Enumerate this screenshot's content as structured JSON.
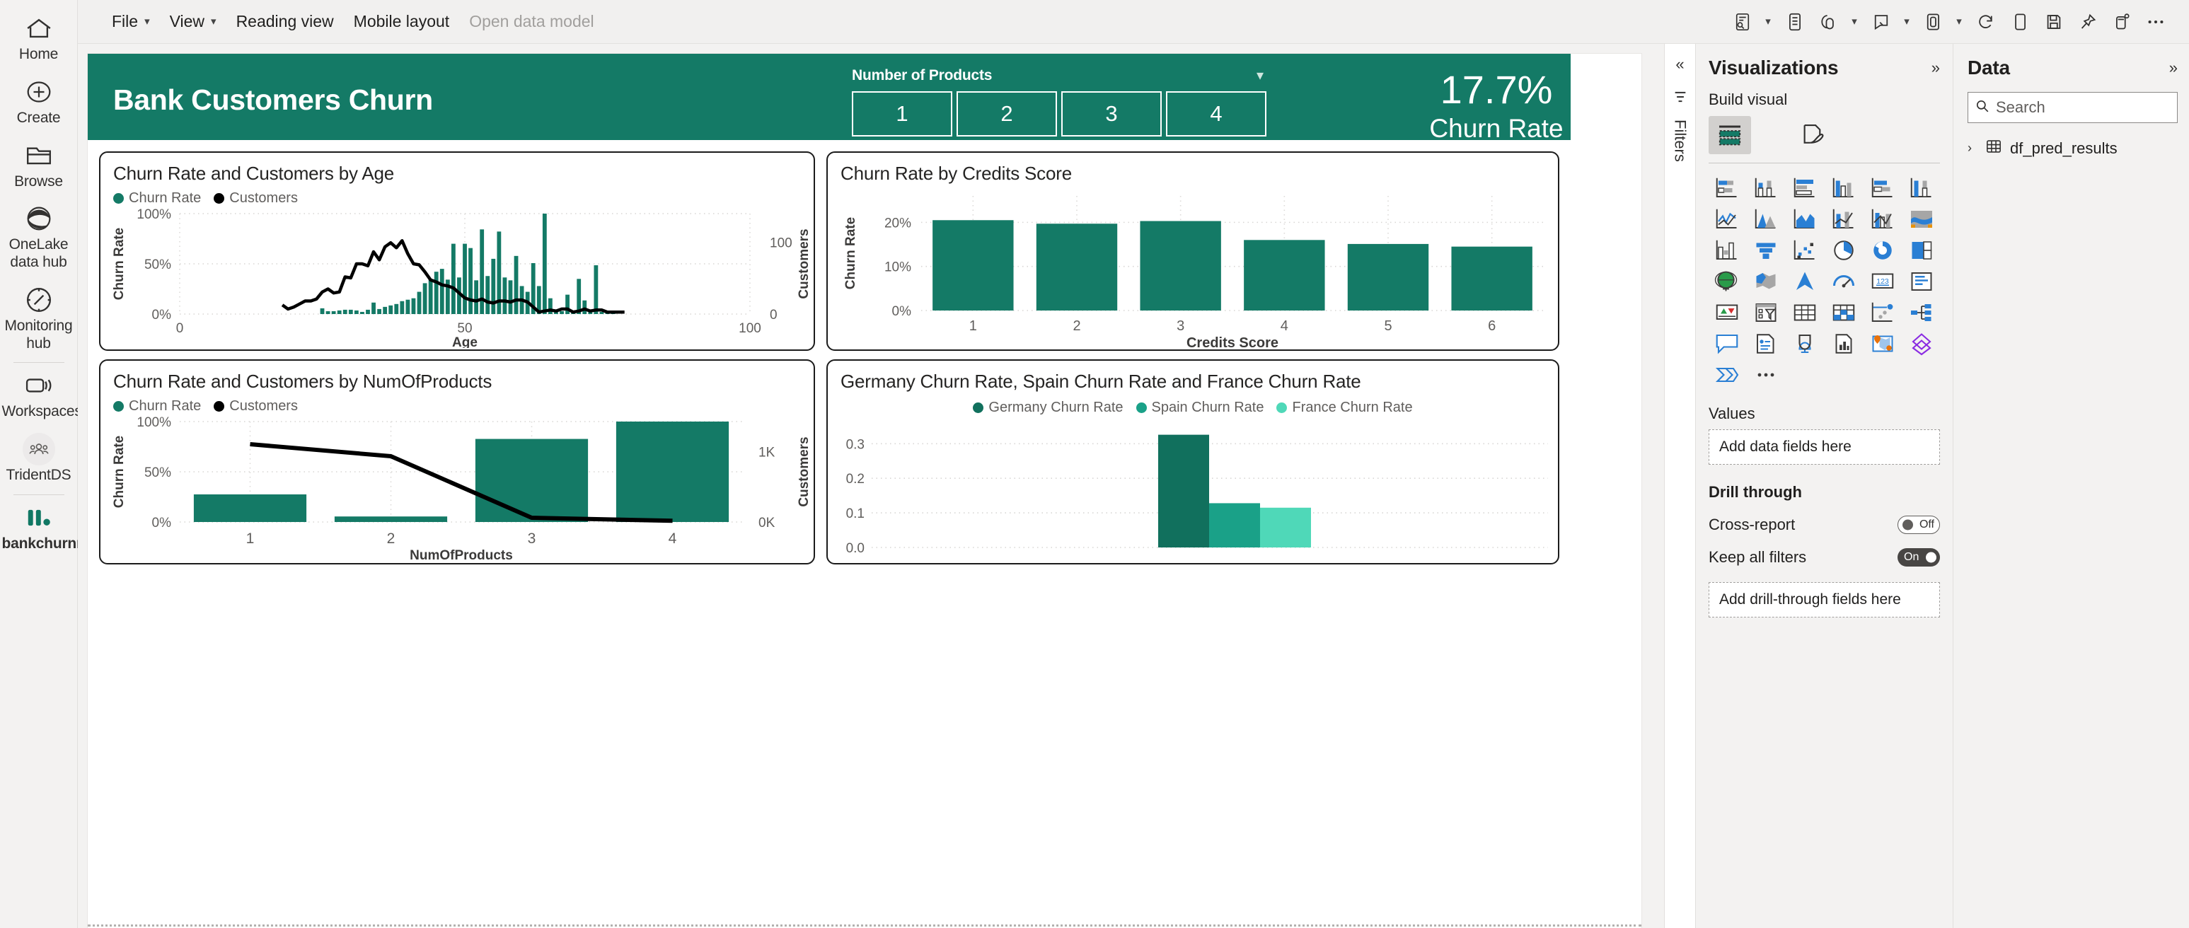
{
  "left_nav": {
    "items": [
      {
        "label": "Home",
        "icon": "home-icon"
      },
      {
        "label": "Create",
        "icon": "plus-circle-icon"
      },
      {
        "label": "Browse",
        "icon": "folder-icon"
      },
      {
        "label": "OneLake data hub",
        "icon": "onelake-icon"
      },
      {
        "label": "Monitoring hub",
        "icon": "monitoring-icon"
      }
    ],
    "workspaces": {
      "label": "Workspaces",
      "icon": "workspaces-icon"
    },
    "tenant": {
      "label": "TridentDS",
      "icon": "people-icon"
    },
    "report": {
      "label": "bankchurnreport",
      "icon": "report-bars-icon"
    }
  },
  "ribbon": {
    "menus": [
      {
        "label": "File",
        "has_chevron": true,
        "disabled": false
      },
      {
        "label": "View",
        "has_chevron": true,
        "disabled": false
      },
      {
        "label": "Reading view",
        "has_chevron": false,
        "disabled": false
      },
      {
        "label": "Mobile layout",
        "has_chevron": false,
        "disabled": false
      },
      {
        "label": "Open data model",
        "has_chevron": false,
        "disabled": true
      }
    ],
    "icons": [
      {
        "name": "subscribe-icon",
        "chevron": true
      },
      {
        "name": "bookmarks-icon",
        "chevron": false
      },
      {
        "name": "share-icon",
        "chevron": true
      },
      {
        "name": "chat-comment-icon",
        "chevron": true
      },
      {
        "name": "copy-page-icon",
        "chevron": true
      },
      {
        "name": "refresh-icon",
        "chevron": false
      },
      {
        "name": "duplicate-page-icon",
        "chevron": false
      },
      {
        "name": "save-icon",
        "chevron": false
      },
      {
        "name": "pin-icon",
        "chevron": false
      },
      {
        "name": "teams-icon",
        "chevron": false
      },
      {
        "name": "more-options-icon",
        "chevron": false
      }
    ]
  },
  "report": {
    "title": "Bank Customers Churn",
    "accent_color": "#147a66",
    "slicer": {
      "title": "Number of Products",
      "options": [
        "1",
        "2",
        "3",
        "4"
      ]
    },
    "kpi": {
      "value": "17.7%",
      "label": "Churn Rate"
    }
  },
  "chart_data": [
    {
      "type": "bar",
      "id": "churn-rate-and-customers-by-age",
      "title": "Churn Rate and Customers by Age",
      "legend": [
        {
          "name": "Churn Rate",
          "color": "#147a66"
        },
        {
          "name": "Customers",
          "color": "#000000"
        }
      ],
      "legend_position": "top-left",
      "xlabel": "Age",
      "ylabel": "Churn Rate",
      "y2label": "Customers",
      "xlim": [
        0,
        100
      ],
      "ylim": [
        0,
        1
      ],
      "y2lim": [
        0,
        140
      ],
      "xticks": [
        "0",
        "50",
        "100"
      ],
      "yticks": [
        "0%",
        "50%",
        "100%"
      ],
      "y2ticks": [
        "0",
        "100"
      ],
      "grid": true,
      "series": [
        {
          "name": "Customers",
          "render": "bars",
          "color": "#147a66",
          "x": [
            25,
            26,
            27,
            28,
            29,
            30,
            31,
            32,
            33,
            34,
            35,
            36,
            37,
            38,
            39,
            40,
            41,
            42,
            43,
            44,
            45,
            46,
            47,
            48,
            49,
            50,
            51,
            52,
            53,
            54,
            55,
            56,
            57,
            58,
            59,
            60,
            61,
            62,
            63,
            64,
            65,
            66,
            67,
            68,
            69,
            70,
            71,
            72,
            73,
            74,
            75,
            76
          ],
          "values": [
            8,
            4,
            4,
            5,
            6,
            6,
            5,
            3,
            6,
            16,
            7,
            10,
            12,
            14,
            18,
            20,
            22,
            31,
            43,
            48,
            59,
            63,
            48,
            98,
            51,
            98,
            92,
            47,
            118,
            53,
            77,
            115,
            51,
            47,
            81,
            39,
            31,
            71,
            39,
            140,
            22,
            4,
            4,
            27,
            3,
            49,
            19,
            4,
            68,
            3,
            3,
            4
          ]
        },
        {
          "name": "Churn Rate",
          "render": "line",
          "color": "#000000",
          "x": [
            18,
            19,
            20,
            21,
            22,
            23,
            24,
            25,
            26,
            27,
            28,
            29,
            30,
            31,
            32,
            33,
            34,
            35,
            36,
            37,
            38,
            39,
            40,
            41,
            42,
            43,
            44,
            45,
            46,
            47,
            48,
            49,
            50,
            51,
            52,
            53,
            54,
            55,
            56,
            57,
            58,
            59,
            60,
            61,
            62,
            63,
            64,
            65,
            66,
            67,
            68,
            69,
            70,
            71,
            72,
            73,
            74,
            75,
            76,
            77,
            78
          ],
          "values": [
            0.09,
            0.05,
            0.07,
            0.1,
            0.13,
            0.13,
            0.15,
            0.22,
            0.25,
            0.21,
            0.22,
            0.37,
            0.36,
            0.5,
            0.5,
            0.48,
            0.62,
            0.54,
            0.67,
            0.71,
            0.66,
            0.73,
            0.6,
            0.5,
            0.49,
            0.42,
            0.34,
            0.32,
            0.29,
            0.28,
            0.26,
            0.21,
            0.16,
            0.14,
            0.13,
            0.15,
            0.12,
            0.11,
            0.13,
            0.13,
            0.12,
            0.14,
            0.14,
            0.12,
            0.07,
            0.02,
            0.03,
            0.04,
            0.03,
            0.05,
            0.05,
            0.02,
            0.03,
            0.05,
            0.03,
            0.04,
            0.04,
            0.02,
            0.02,
            0.02,
            0.02
          ]
        }
      ]
    },
    {
      "type": "bar",
      "id": "churn-rate-by-credits-score",
      "title": "Churn Rate by Credits Score",
      "xlabel": "Credits Score",
      "ylabel": "Churn Rate",
      "categories": [
        "1",
        "2",
        "3",
        "4",
        "5",
        "6"
      ],
      "values": [
        0.205,
        0.197,
        0.203,
        0.16,
        0.151,
        0.145
      ],
      "color": "#147a66",
      "ylim": [
        0,
        0.26
      ],
      "yticks": [
        "0%",
        "10%",
        "20%"
      ],
      "grid": true
    },
    {
      "type": "bar",
      "id": "churn-rate-and-customers-by-numofproducts",
      "title": "Churn Rate and Customers by NumOfProducts",
      "legend": [
        {
          "name": "Churn Rate",
          "color": "#147a66"
        },
        {
          "name": "Customers",
          "color": "#000000"
        }
      ],
      "legend_position": "top-left",
      "xlabel": "NumOfProducts",
      "ylabel": "Churn Rate",
      "y2label": "Customers",
      "categories": [
        "1",
        "2",
        "3",
        "4"
      ],
      "ylim": [
        0,
        1
      ],
      "yticks": [
        "0%",
        "50%",
        "100%"
      ],
      "y2ticks": [
        "0K",
        "1K"
      ],
      "grid": true,
      "series": [
        {
          "name": "Churn Rate",
          "render": "bars",
          "color": "#147a66",
          "values": [
            0.275,
            0.055,
            0.827,
            1.0
          ]
        },
        {
          "name": "Customers",
          "render": "line",
          "color": "#000000",
          "values": [
            0.775,
            0.655,
            0.042,
            0.012
          ]
        }
      ]
    },
    {
      "type": "bar",
      "id": "germany-spain-france-churn-rate",
      "title": "Germany Churn Rate, Spain Churn Rate and France Churn Rate",
      "legend_position": "top-center",
      "categories": [
        "Germany Churn Rate",
        "Spain Churn Rate",
        "France Churn Rate"
      ],
      "values": [
        0.326,
        0.128,
        0.115
      ],
      "colors": [
        "#11705d",
        "#1aa188",
        "#4fd8b8"
      ],
      "ylim": [
        0,
        0.36
      ],
      "yticks": [
        "0.0",
        "0.1",
        "0.2",
        "0.3"
      ],
      "grid": true
    }
  ],
  "filters_rail": {
    "label": "Filters",
    "collapse_icon": "chevron-double-left-icon",
    "filter_icon": "filter-bars-icon"
  },
  "visualizations": {
    "title": "Visualizations",
    "collapse_icon": "chevron-double-right-icon",
    "build_label": "Build visual",
    "build_tabs": [
      {
        "name": "fields-build-icon",
        "selected": true
      },
      {
        "name": "format-paintbrush-icon",
        "selected": false
      }
    ],
    "viz_icons": [
      "stacked-bar-chart-icon",
      "stacked-column-chart-icon",
      "clustered-bar-chart-icon",
      "clustered-column-chart-icon",
      "hundred-percent-stacked-bar-icon",
      "hundred-percent-stacked-column-icon",
      "line-chart-icon",
      "area-chart-icon",
      "stacked-area-chart-icon",
      "line-stacked-column-chart-icon",
      "line-clustered-column-chart-icon",
      "ribbon-chart-icon",
      "waterfall-chart-icon",
      "funnel-chart-icon",
      "scatter-chart-icon",
      "pie-chart-icon",
      "donut-chart-icon",
      "treemap-icon",
      "map-globe-icon",
      "filled-map-icon",
      "azure-map-icon",
      "gauge-icon",
      "card-number-icon",
      "multi-row-card-icon",
      "kpi-icon",
      "slicer-icon",
      "table-icon",
      "matrix-icon",
      "key-influencers-icon",
      "decomposition-tree-icon",
      "smart-narrative-icon",
      "metrics-icon",
      "paginated-report-icon",
      "r-script-visual-icon",
      "arcgis-map-icon",
      "power-apps-icon",
      "power-automate-icon",
      "more-visuals-icon"
    ],
    "values_label": "Values",
    "values_dropzone": "Add data fields here",
    "drill_through_label": "Drill through",
    "cross_report": {
      "label": "Cross-report",
      "state": "Off"
    },
    "keep_all_filters": {
      "label": "Keep all filters",
      "state": "On"
    },
    "drill_dropzone": "Add drill-through fields here"
  },
  "data_pane": {
    "title": "Data",
    "collapse_icon": "chevron-double-right-icon",
    "search_placeholder": "Search",
    "search_icon": "search-icon",
    "tables": [
      {
        "name": "df_pred_results",
        "icon": "table-grid-icon",
        "expand_icon": "chevron-right-icon"
      }
    ]
  }
}
